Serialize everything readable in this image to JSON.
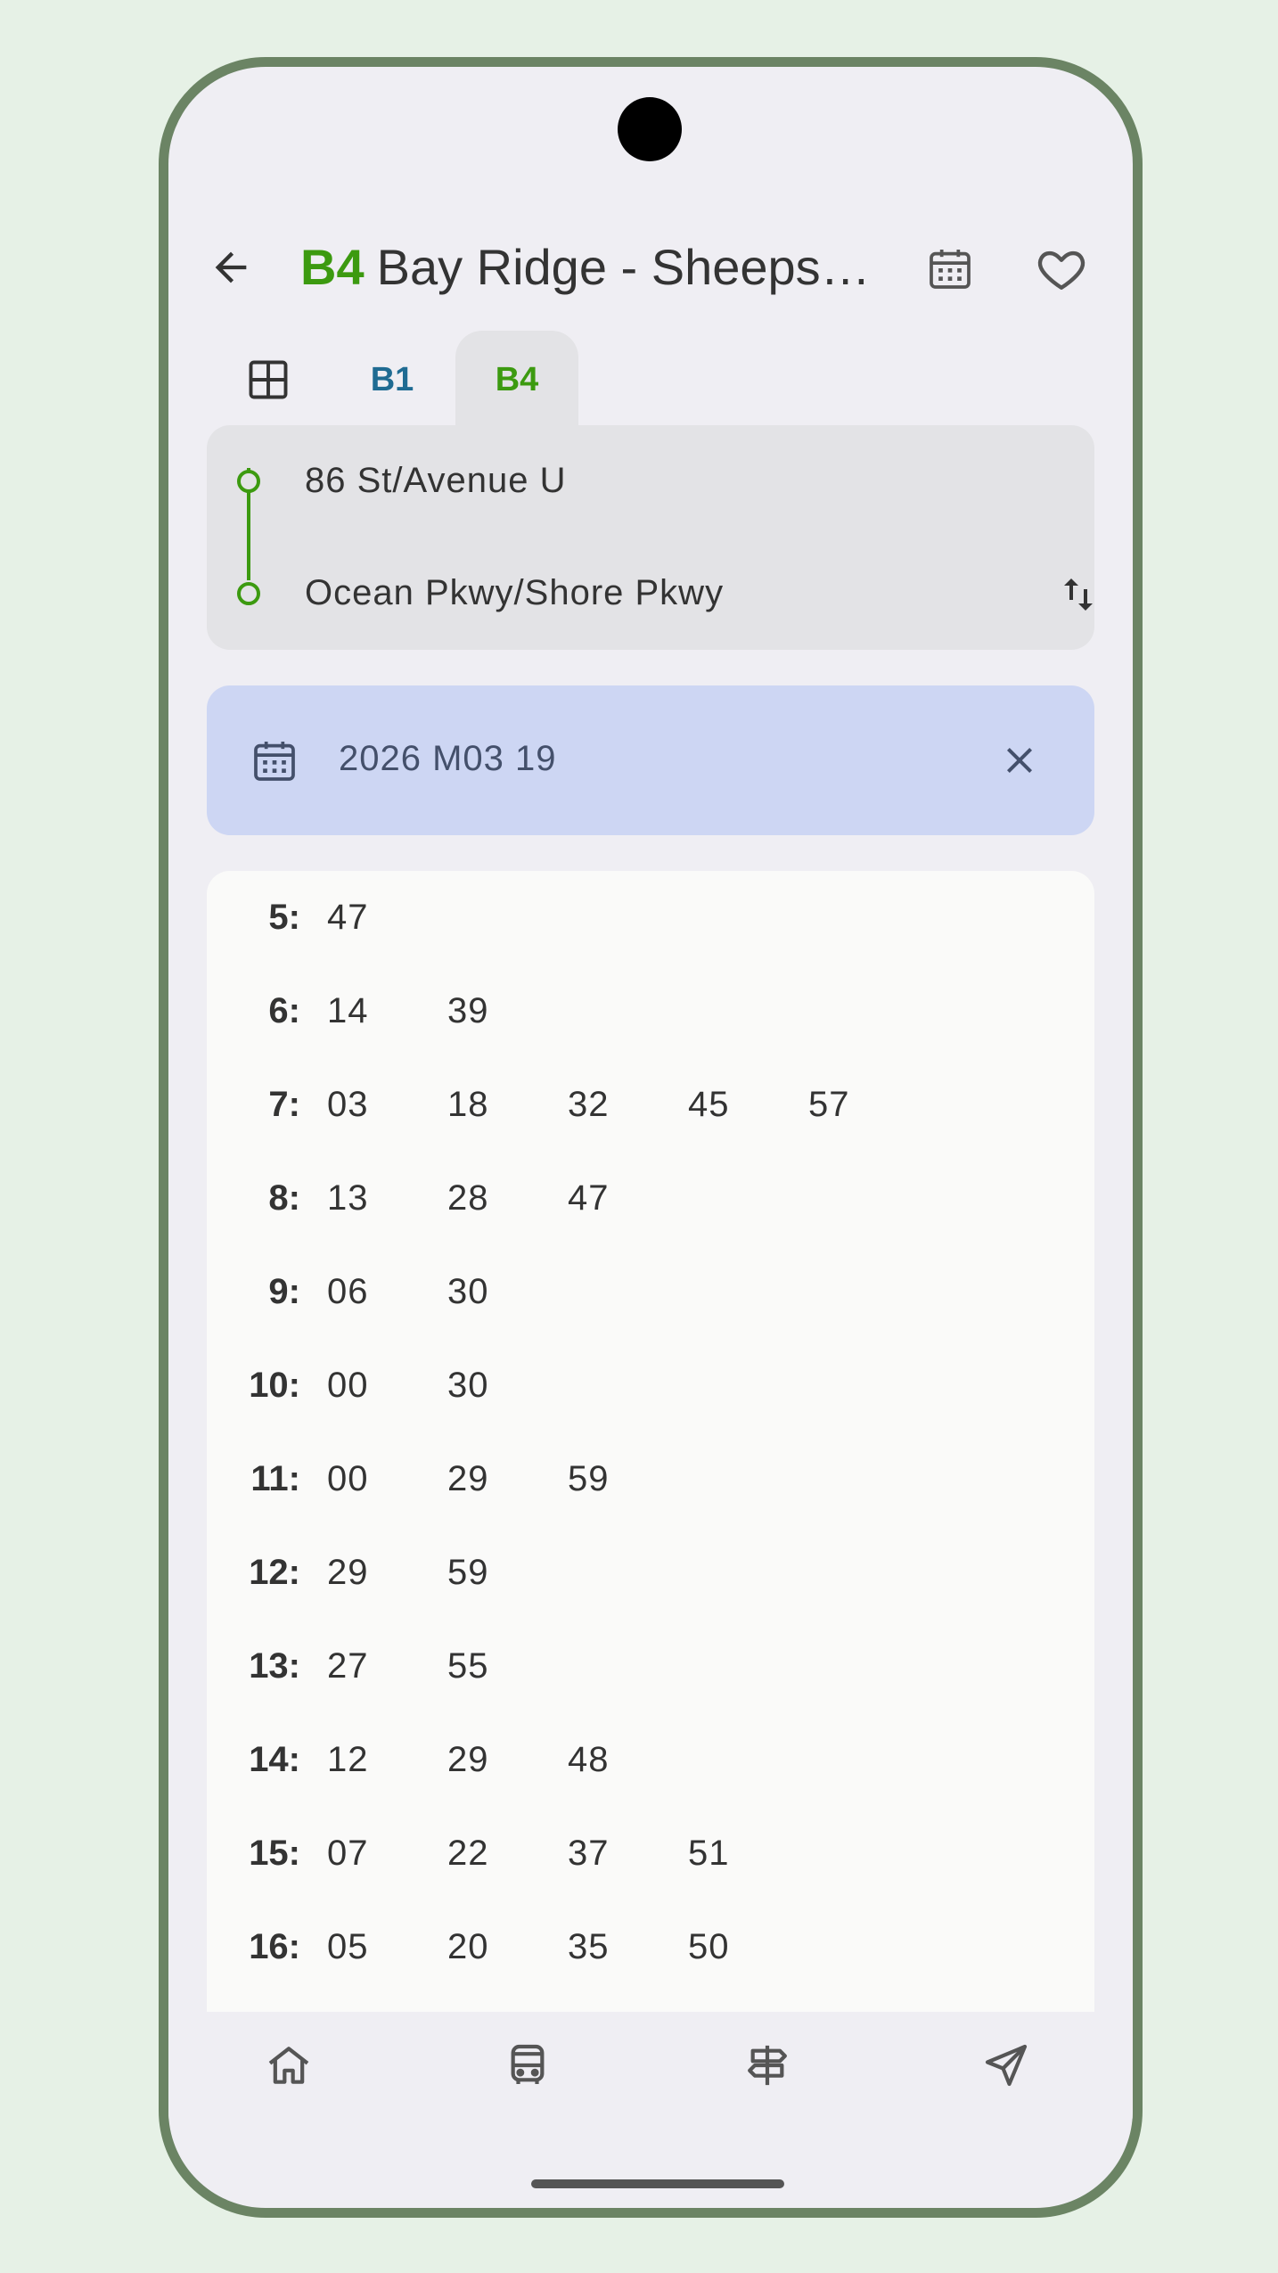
{
  "header": {
    "route_code": "B4",
    "title": "Bay Ridge - Sheepshead Bay"
  },
  "tabs": [
    {
      "label": "B1",
      "color": "#1f6b92"
    },
    {
      "label": "B4",
      "color": "#3c9a10",
      "selected": true
    }
  ],
  "route": {
    "from": "86 St/Avenue U",
    "to": "Ocean Pkwy/Shore Pkwy"
  },
  "date_filter": {
    "value": "2026 M03 19"
  },
  "schedule": [
    {
      "hour": "5:",
      "minutes": [
        "47"
      ]
    },
    {
      "hour": "6:",
      "minutes": [
        "14",
        "39"
      ]
    },
    {
      "hour": "7:",
      "minutes": [
        "03",
        "18",
        "32",
        "45",
        "57"
      ]
    },
    {
      "hour": "8:",
      "minutes": [
        "13",
        "28",
        "47"
      ]
    },
    {
      "hour": "9:",
      "minutes": [
        "06",
        "30"
      ]
    },
    {
      "hour": "10:",
      "minutes": [
        "00",
        "30"
      ]
    },
    {
      "hour": "11:",
      "minutes": [
        "00",
        "29",
        "59"
      ]
    },
    {
      "hour": "12:",
      "minutes": [
        "29",
        "59"
      ]
    },
    {
      "hour": "13:",
      "minutes": [
        "27",
        "55"
      ]
    },
    {
      "hour": "14:",
      "minutes": [
        "12",
        "29",
        "48"
      ]
    },
    {
      "hour": "15:",
      "minutes": [
        "07",
        "22",
        "37",
        "51"
      ]
    },
    {
      "hour": "16:",
      "minutes": [
        "05",
        "20",
        "35",
        "50"
      ]
    }
  ],
  "nav": [
    "home-icon",
    "bus-icon",
    "signpost-icon",
    "navigation-icon"
  ],
  "colors": {
    "accent": "#3c9a10",
    "b1": "#1f6b92",
    "date_chip": "#cdd6f3",
    "frame": "#6b8464"
  }
}
